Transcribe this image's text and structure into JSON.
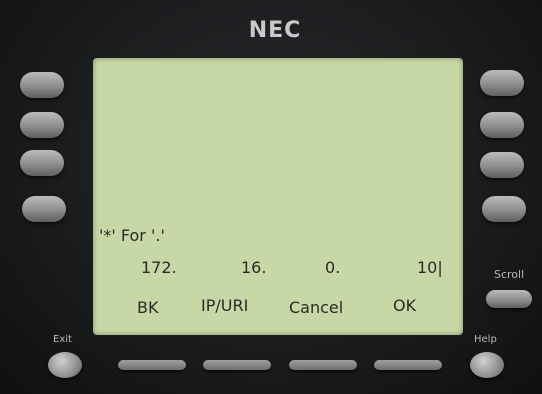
{
  "brand": "NEC",
  "lcd": {
    "hint": "'*' For '.'",
    "ip": [
      "172.",
      "16.",
      "0.",
      "10|"
    ],
    "softkeys": [
      "BK",
      "IP/URI",
      "Cancel",
      "OK"
    ]
  },
  "keys": {
    "exit_label": "Exit",
    "help_label": "Help",
    "scroll_label": "Scroll"
  },
  "colors": {
    "lcd_background": "#c7d8a6",
    "bezel": "#1b1c1e"
  }
}
